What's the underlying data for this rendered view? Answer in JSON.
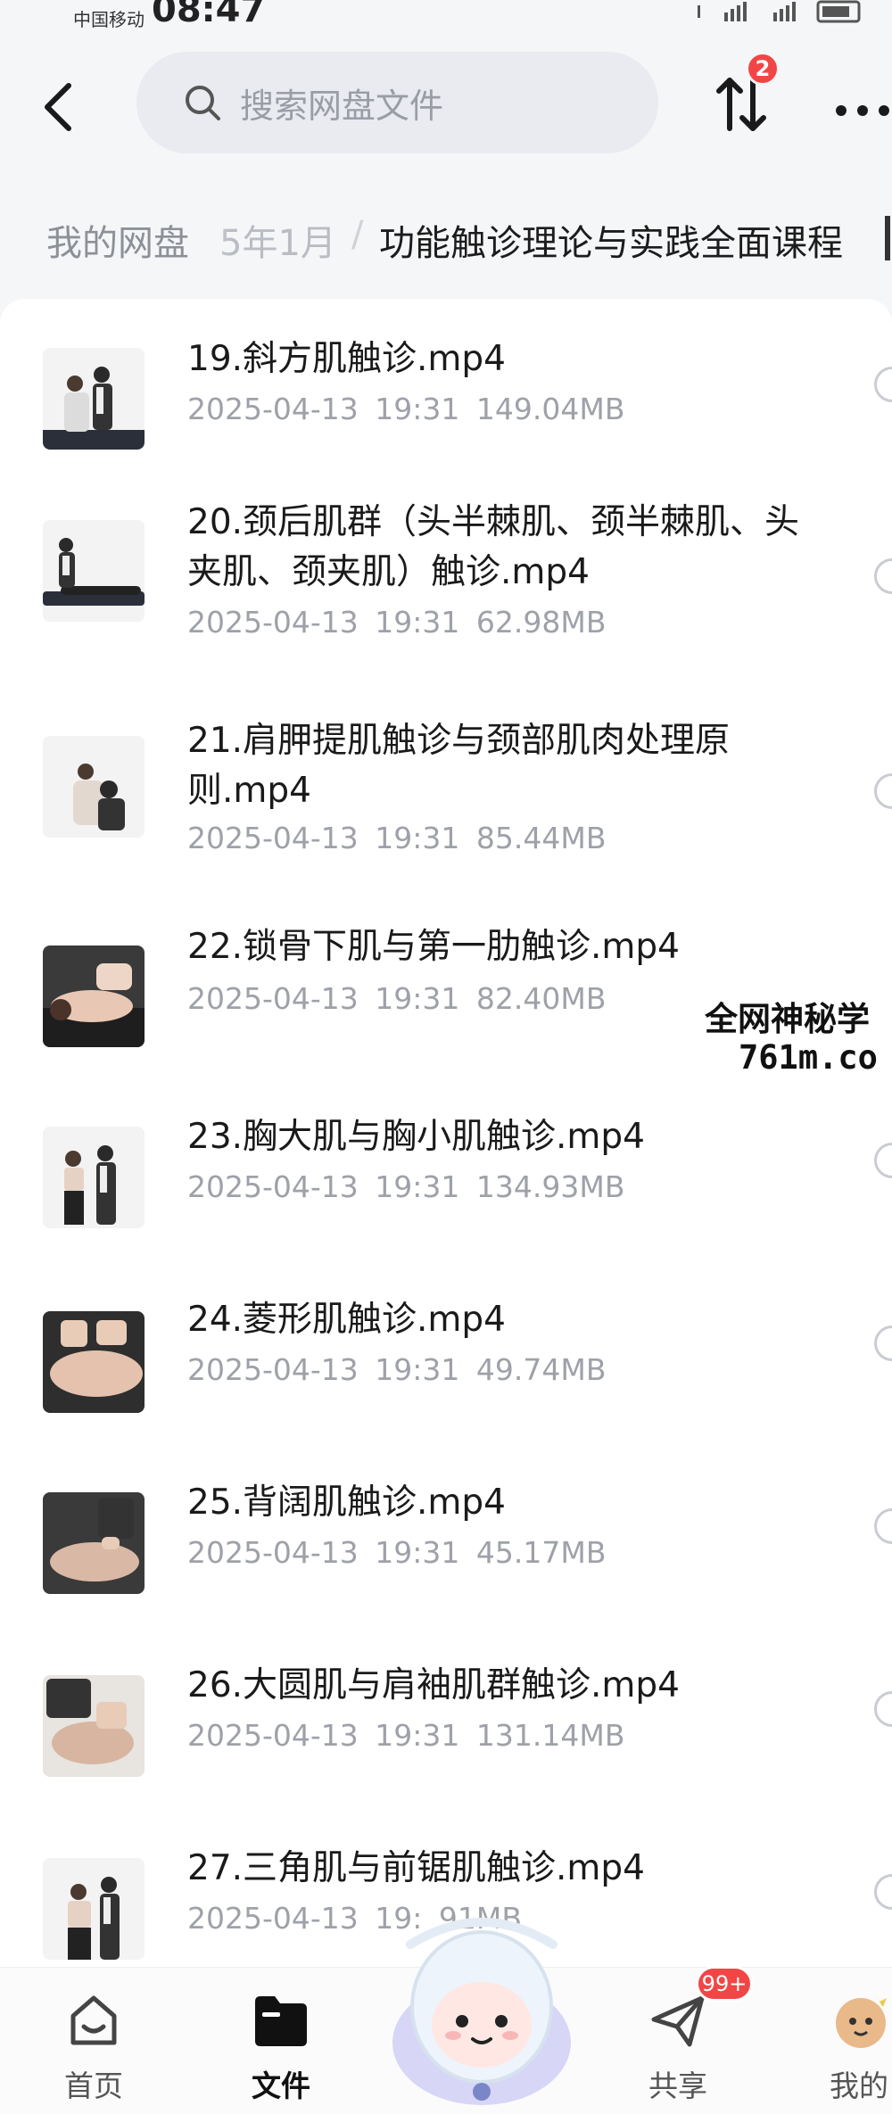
{
  "status_bar": {
    "carrier": "中国移动",
    "time": "08:47"
  },
  "top_bar": {
    "search_placeholder": "搜索网盘文件",
    "transfer_badge": "2"
  },
  "breadcrumb": {
    "root": "我的网盘",
    "middle": "5年1月",
    "separator": "/",
    "current": "功能触诊理论与实践全面课程"
  },
  "files": [
    {
      "name": "19.斜方肌触诊.mp4",
      "date": "2025-04-13",
      "time": "19:31",
      "size": "149.04MB"
    },
    {
      "name": "20.颈后肌群（头半棘肌、颈半棘肌、头夹肌、颈夹肌）触诊.mp4",
      "date": "2025-04-13",
      "time": "19:31",
      "size": "62.98MB"
    },
    {
      "name": "21.肩胛提肌触诊与颈部肌肉处理原则.mp4",
      "date": "2025-04-13",
      "time": "19:31",
      "size": "85.44MB"
    },
    {
      "name": "22.锁骨下肌与第一肋触诊.mp4",
      "date": "2025-04-13",
      "time": "19:31",
      "size": "82.40MB"
    },
    {
      "name": "23.胸大肌与胸小肌触诊.mp4",
      "date": "2025-04-13",
      "time": "19:31",
      "size": "134.93MB"
    },
    {
      "name": "24.菱形肌触诊.mp4",
      "date": "2025-04-13",
      "time": "19:31",
      "size": "49.74MB"
    },
    {
      "name": "25.背阔肌触诊.mp4",
      "date": "2025-04-13",
      "time": "19:31",
      "size": "45.17MB"
    },
    {
      "name": "26.大圆肌与肩袖肌群触诊.mp4",
      "date": "2025-04-13",
      "time": "19:31",
      "size": "131.14MB"
    },
    {
      "name": "27.三角肌与前锯肌触诊.mp4",
      "date": "2025-04-13",
      "time": "19:",
      "size": "91MB"
    }
  ],
  "watermark": {
    "line1": "全网神秘学",
    "line2": "761m.co"
  },
  "tabs": [
    {
      "label": "首页",
      "icon": "home-icon"
    },
    {
      "label": "文件",
      "icon": "folder-icon"
    },
    {
      "label": "共享",
      "icon": "send-icon"
    },
    {
      "label": "我的",
      "icon": "avatar-icon"
    }
  ],
  "share_badge": "99+",
  "colors": {
    "accent_red": "#f24646",
    "text_primary": "#1a1a1a",
    "text_secondary": "#9ea1a8",
    "search_bg": "#e9ebf0"
  }
}
